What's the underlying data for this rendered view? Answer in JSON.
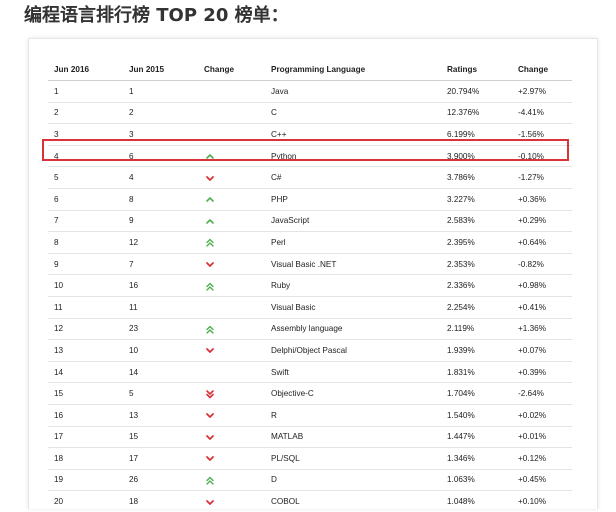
{
  "page": {
    "title": "编程语言排行榜 TOP 20 榜单："
  },
  "table": {
    "headers": [
      "Jun 2016",
      "Jun 2015",
      "Change",
      "Programming Language",
      "Ratings",
      "Change"
    ],
    "rows": [
      {
        "jun2016": "1",
        "jun2015": "1",
        "trend": "none",
        "language": "Java",
        "rating": "20.794%",
        "change": "+2.97%"
      },
      {
        "jun2016": "2",
        "jun2015": "2",
        "trend": "none",
        "language": "C",
        "rating": "12.376%",
        "change": "-4.41%"
      },
      {
        "jun2016": "3",
        "jun2015": "3",
        "trend": "none",
        "language": "C++",
        "rating": "6.199%",
        "change": "-1.56%"
      },
      {
        "jun2016": "4",
        "jun2015": "6",
        "trend": "up",
        "language": "Python",
        "rating": "3.900%",
        "change": "-0.10%"
      },
      {
        "jun2016": "5",
        "jun2015": "4",
        "trend": "down",
        "language": "C#",
        "rating": "3.786%",
        "change": "-1.27%"
      },
      {
        "jun2016": "6",
        "jun2015": "8",
        "trend": "up",
        "language": "PHP",
        "rating": "3.227%",
        "change": "+0.36%"
      },
      {
        "jun2016": "7",
        "jun2015": "9",
        "trend": "up",
        "language": "JavaScript",
        "rating": "2.583%",
        "change": "+0.29%"
      },
      {
        "jun2016": "8",
        "jun2015": "12",
        "trend": "double-up",
        "language": "Perl",
        "rating": "2.395%",
        "change": "+0.64%"
      },
      {
        "jun2016": "9",
        "jun2015": "7",
        "trend": "down",
        "language": "Visual Basic .NET",
        "rating": "2.353%",
        "change": "-0.82%"
      },
      {
        "jun2016": "10",
        "jun2015": "16",
        "trend": "double-up",
        "language": "Ruby",
        "rating": "2.336%",
        "change": "+0.98%"
      },
      {
        "jun2016": "11",
        "jun2015": "11",
        "trend": "none",
        "language": "Visual Basic",
        "rating": "2.254%",
        "change": "+0.41%"
      },
      {
        "jun2016": "12",
        "jun2015": "23",
        "trend": "double-up",
        "language": "Assembly language",
        "rating": "2.119%",
        "change": "+1.36%"
      },
      {
        "jun2016": "13",
        "jun2015": "10",
        "trend": "down",
        "language": "Delphi/Object Pascal",
        "rating": "1.939%",
        "change": "+0.07%"
      },
      {
        "jun2016": "14",
        "jun2015": "14",
        "trend": "none",
        "language": "Swift",
        "rating": "1.831%",
        "change": "+0.39%"
      },
      {
        "jun2016": "15",
        "jun2015": "5",
        "trend": "double-down",
        "language": "Objective-C",
        "rating": "1.704%",
        "change": "-2.64%"
      },
      {
        "jun2016": "16",
        "jun2015": "13",
        "trend": "down",
        "language": "R",
        "rating": "1.540%",
        "change": "+0.02%"
      },
      {
        "jun2016": "17",
        "jun2015": "15",
        "trend": "down",
        "language": "MATLAB",
        "rating": "1.447%",
        "change": "+0.01%"
      },
      {
        "jun2016": "18",
        "jun2015": "17",
        "trend": "down",
        "language": "PL/SQL",
        "rating": "1.346%",
        "change": "+0.12%"
      },
      {
        "jun2016": "19",
        "jun2015": "26",
        "trend": "double-up",
        "language": "D",
        "rating": "1.063%",
        "change": "+0.45%"
      },
      {
        "jun2016": "20",
        "jun2015": "18",
        "trend": "down",
        "language": "COBOL",
        "rating": "1.048%",
        "change": "+0.10%"
      }
    ]
  },
  "highlighted_language": "Python",
  "icons": {
    "up": "chevron-up-icon",
    "double-up": "double-chevron-up-icon",
    "down": "chevron-down-icon",
    "double-down": "double-chevron-down-icon"
  },
  "colors": {
    "up": "#4caf50",
    "down": "#d9333a",
    "highlight": "#d9333a"
  }
}
